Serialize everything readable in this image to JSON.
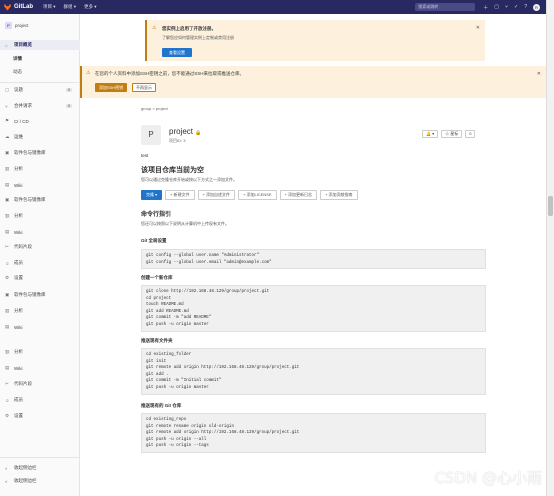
{
  "topbar": {
    "brand": "GitLab",
    "nav": [
      "项目 ▾",
      "群组 ▾",
      "更多 ▾"
    ],
    "search_placeholder": "搜索或跳转",
    "avatar": "R"
  },
  "sidebar": {
    "project_avatar": "P",
    "project_name": "project",
    "items": [
      {
        "label": "项目概览",
        "icon": "home-icon",
        "active": true
      },
      {
        "label": "详情",
        "sub": true,
        "current": true
      },
      {
        "label": "动态",
        "sub": true
      },
      {
        "label": "议题",
        "icon": "issues-icon",
        "badge": "0"
      },
      {
        "label": "合并请求",
        "icon": "merge-icon",
        "badge": "0"
      },
      {
        "label": "CI / CD",
        "icon": "rocket-icon"
      },
      {
        "label": "运维",
        "icon": "cloud-icon"
      },
      {
        "label": "软件包与镜像库",
        "icon": "package-icon"
      },
      {
        "label": "分析",
        "icon": "chart-icon"
      },
      {
        "label": "Wiki",
        "icon": "book-icon"
      },
      {
        "label": "软件包与镜像库",
        "icon": "package-icon"
      },
      {
        "label": "分析",
        "icon": "chart-icon"
      },
      {
        "label": "Wiki",
        "icon": "book-icon"
      },
      {
        "label": "代码片段",
        "icon": "scissors-icon"
      },
      {
        "label": "成员",
        "icon": "users-icon"
      },
      {
        "label": "设置",
        "icon": "gear-icon"
      },
      {
        "label": "软件包与镜像库",
        "icon": "package-icon"
      },
      {
        "label": "分析",
        "icon": "chart-icon"
      },
      {
        "label": "Wiki",
        "icon": "book-icon"
      },
      {
        "label": "分析",
        "icon": "chart-icon"
      },
      {
        "label": "Wiki",
        "icon": "book-icon"
      },
      {
        "label": "代码片段",
        "icon": "scissors-icon"
      },
      {
        "label": "成员",
        "icon": "users-icon"
      },
      {
        "label": "设置",
        "icon": "gear-icon"
      }
    ],
    "collapse": [
      "收起侧边栏",
      "收起侧边栏"
    ]
  },
  "alert_signup": {
    "title": "您实例上启用了开放注册。",
    "desc": "了解您应如何管理实例上定制或禁用注册",
    "button": "查看设置"
  },
  "alert_ssh": {
    "text": "在您的个人资料中添加SSH密钥之前，您不能通过SSH来拉取或推送仓库。",
    "add_button": "添加SSH密钥",
    "dismiss_button": "不再显示"
  },
  "breadcrumb": "group > project",
  "project": {
    "avatar": "P",
    "name": "project",
    "id_label": "项目ID: 3",
    "description": "test",
    "notif": "🔔 ▾",
    "star": "☆ 星标",
    "star_count": "0"
  },
  "empty": {
    "title": "该项目仓库当前为空",
    "hint": "您可以通过克隆仓库开始或按以下方式之一添加文件。",
    "buttons": [
      "克隆 ▾",
      "+ 新建文件",
      "+ 添加自述文件",
      "+ 添加LICENSE",
      "+ 添加更新日志",
      "+ 添加贡献指南"
    ]
  },
  "cli": {
    "title": "命令行指引",
    "hint": "您还可以按照以下说明从计算机中上传现有文件。",
    "sections": [
      {
        "heading": "Git 全局设置",
        "code": "git config --global user.name \"Administrator\"\ngit config --global user.email \"admin@example.com\""
      },
      {
        "heading": "创建一个新仓库",
        "code": "git clone http://192.168.48.129/group/project.git\ncd project\ntouch README.md\ngit add README.md\ngit commit -m \"add README\"\ngit push -u origin master"
      },
      {
        "heading": "推送现有文件夹",
        "code": "cd existing_folder\ngit init\ngit remote add origin http://192.168.48.129/group/project.git\ngit add .\ngit commit -m \"Initial commit\"\ngit push -u origin master"
      },
      {
        "heading": "推送现有的 Git 仓库",
        "code": "cd existing_repo\ngit remote rename origin old-origin\ngit remote add origin http://192.168.48.129/group/project.git\ngit push -u origin --all\ngit push -u origin --tags"
      }
    ]
  },
  "watermark": "CSDN @心小雨"
}
